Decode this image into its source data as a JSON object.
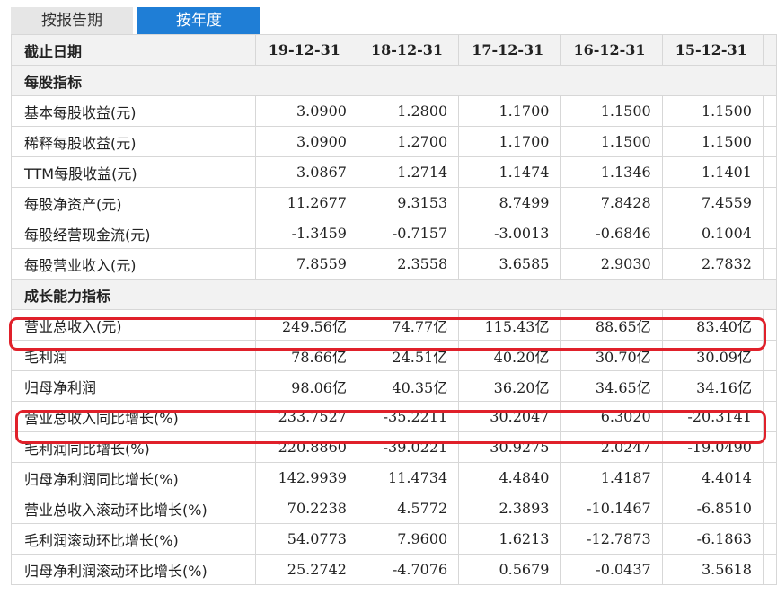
{
  "tabs": {
    "report": "按报告期",
    "year": "按年度"
  },
  "header": {
    "label": "截止日期",
    "dates": [
      "19-12-31",
      "18-12-31",
      "17-12-31",
      "16-12-31",
      "15-12-31"
    ]
  },
  "sections": [
    {
      "title": "每股指标",
      "rows": [
        {
          "label": "基本每股收益(元)",
          "values": [
            "3.0900",
            "1.2800",
            "1.1700",
            "1.1500",
            "1.1500"
          ]
        },
        {
          "label": "稀释每股收益(元)",
          "values": [
            "3.0900",
            "1.2700",
            "1.1700",
            "1.1500",
            "1.1500"
          ]
        },
        {
          "label": "TTM每股收益(元)",
          "values": [
            "3.0867",
            "1.2714",
            "1.1474",
            "1.1346",
            "1.1401"
          ]
        },
        {
          "label": "每股净资产(元)",
          "values": [
            "11.2677",
            "9.3153",
            "8.7499",
            "7.8428",
            "7.4559"
          ]
        },
        {
          "label": "每股经营现金流(元)",
          "values": [
            "-1.3459",
            "-0.7157",
            "-3.0013",
            "-0.6846",
            "0.1004"
          ]
        },
        {
          "label": "每股营业收入(元)",
          "values": [
            "7.8559",
            "2.3558",
            "3.6585",
            "2.9030",
            "2.7832"
          ]
        }
      ]
    },
    {
      "title": "成长能力指标",
      "rows": [
        {
          "label": "营业总收入(元)",
          "values": [
            "249.56亿",
            "74.77亿",
            "115.43亿",
            "88.65亿",
            "83.40亿"
          ],
          "highlighted": true
        },
        {
          "label": "毛利润",
          "values": [
            "78.66亿",
            "24.51亿",
            "40.20亿",
            "30.70亿",
            "30.09亿"
          ]
        },
        {
          "label": "归母净利润",
          "values": [
            "98.06亿",
            "40.35亿",
            "36.20亿",
            "34.65亿",
            "34.16亿"
          ]
        },
        {
          "label": "营业总收入同比增长(%)",
          "values": [
            "233.7527",
            "-35.2211",
            "30.2047",
            "6.3020",
            "-20.3141"
          ],
          "highlighted": true
        },
        {
          "label": "毛利润同比增长(%)",
          "values": [
            "220.8860",
            "-39.0221",
            "30.9275",
            "2.0247",
            "-19.0490"
          ]
        },
        {
          "label": "归母净利润同比增长(%)",
          "values": [
            "142.9939",
            "11.4734",
            "4.4840",
            "1.4187",
            "4.4014"
          ]
        },
        {
          "label": "营业总收入滚动环比增长(%)",
          "values": [
            "70.2238",
            "4.5772",
            "2.3893",
            "-10.1467",
            "-6.8510"
          ]
        },
        {
          "label": "毛利润滚动环比增长(%)",
          "values": [
            "54.0773",
            "7.9600",
            "1.6213",
            "-12.7873",
            "-6.1863"
          ]
        },
        {
          "label": "归母净利润滚动环比增长(%)",
          "values": [
            "25.2742",
            "-4.7076",
            "0.5679",
            "-0.0437",
            "3.5618"
          ]
        }
      ]
    }
  ],
  "colors": {
    "accent": "#1f7ed6",
    "highlight": "#e0202a",
    "header_bg": "#f2f2f2"
  }
}
